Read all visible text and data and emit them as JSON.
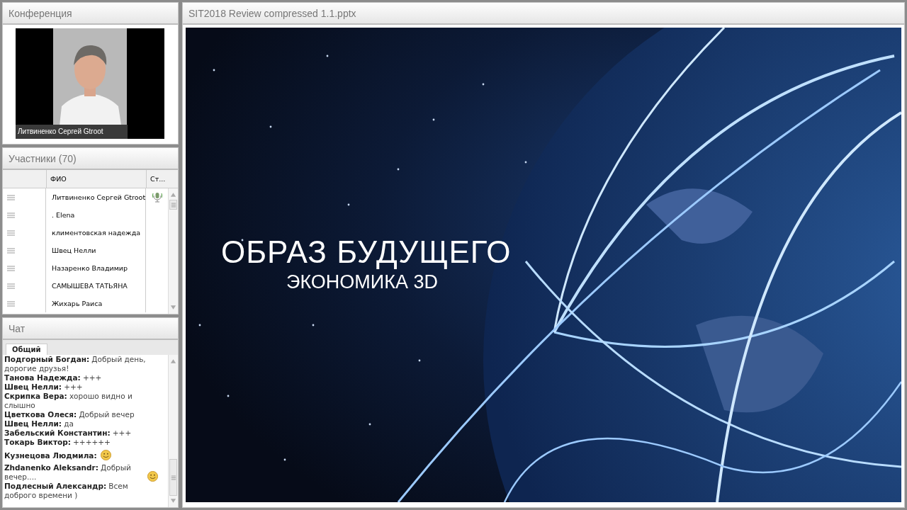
{
  "conference": {
    "title": "Конференция",
    "video": {
      "kind": "picture",
      "caption": "Литвиненко Сергей Gtroot"
    }
  },
  "participants": {
    "title": "Участники (70)",
    "columns": [
      "ФИО",
      "Ст..."
    ],
    "rows": [
      {
        "name": "Литвиненко Сергей Gtroot",
        "speaking": true
      },
      {
        "name": ". Elena",
        "speaking": false
      },
      {
        "name": "климентовская надежда",
        "speaking": false
      },
      {
        "name": "Швец Нелли",
        "speaking": false
      },
      {
        "name": "Назаренко Владимир",
        "speaking": false
      },
      {
        "name": "САМЫШЕВА ТАТЬЯНА",
        "speaking": false
      },
      {
        "name": "Жихарь Раиса",
        "speaking": false
      }
    ]
  },
  "chat": {
    "title": "Чат",
    "tabs": [
      {
        "label": "Общий",
        "selected": true
      }
    ],
    "messages": [
      {
        "author": "Подгорный Богдан:",
        "text": "Добрый день, дорогие друзья!",
        "smiley": false
      },
      {
        "author": "Танова Надежда:",
        "text": "+++",
        "smiley": false
      },
      {
        "author": "Швец Нелли:",
        "text": "+++",
        "smiley": false
      },
      {
        "author": "Скрипка Вера:",
        "text": "хорошо видно и слышно",
        "smiley": false
      },
      {
        "author": "Цветкова Олеся:",
        "text": "Добрый вечер",
        "smiley": false
      },
      {
        "author": "Швец Нелли:",
        "text": "да",
        "smiley": false
      },
      {
        "author": "Забельский Константин:",
        "text": "+++",
        "smiley": false
      },
      {
        "author": "Токарь Виктор:",
        "text": "++++++",
        "smiley": false
      },
      {
        "author": "Кузнецова Людмила:",
        "smiley": true
      },
      {
        "author": "Zhdanenko Aleksandr:",
        "text": "Добрый вечер....",
        "smiley": true
      },
      {
        "author": "Подлесный Александр:",
        "text": "Всем доброго времени )",
        "smiley": false
      }
    ]
  },
  "presentation": {
    "title": "SIT2018 Review compressed 1.1.pptx",
    "slide": {
      "kind": "picture",
      "title": "ОБРАЗ БУДУЩЕГО",
      "subtitle": "ЭКОНОМИКА 3D"
    }
  }
}
